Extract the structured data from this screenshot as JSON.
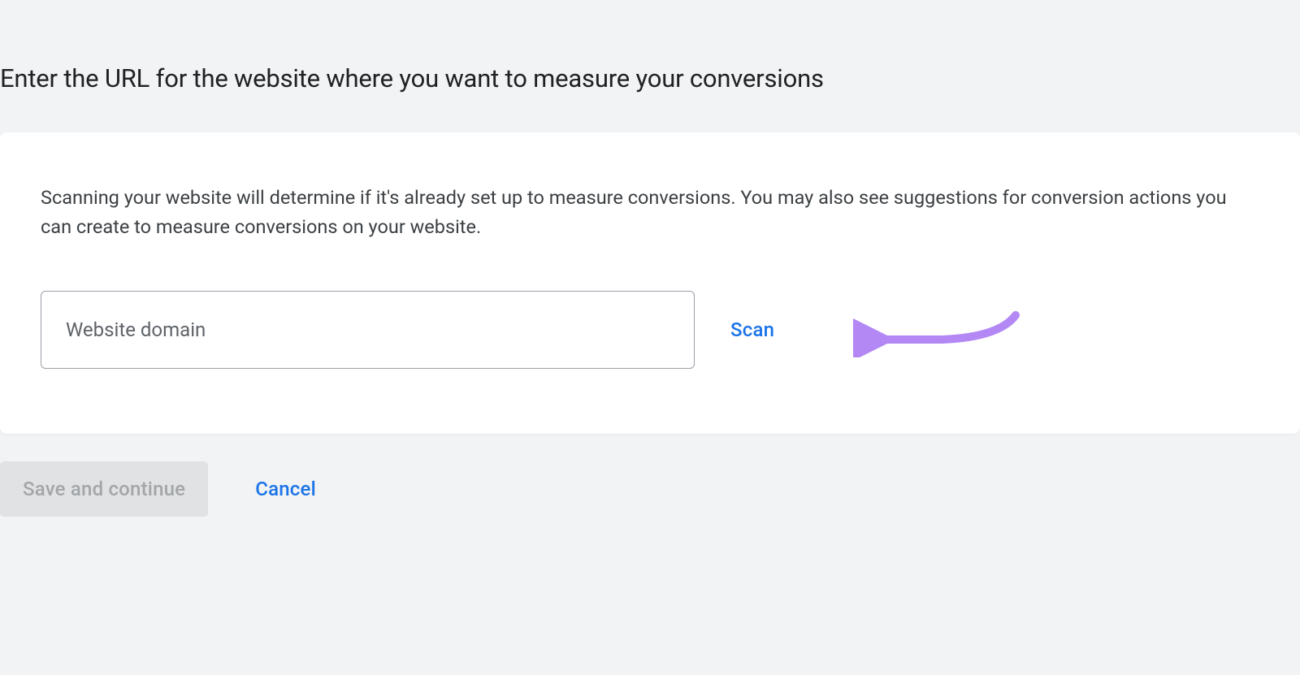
{
  "heading": "Enter the URL for the website where you want to measure your conversions",
  "card": {
    "description": "Scanning your website will determine if it's already set up to measure conversions. You may also see suggestions for conversion actions you can create to measure conversions on your website.",
    "domain_input": {
      "placeholder": "Website domain",
      "value": ""
    },
    "scan_label": "Scan"
  },
  "footer": {
    "save_label": "Save and continue",
    "cancel_label": "Cancel"
  },
  "colors": {
    "page_bg": "#f1f3f4",
    "card_bg": "#ffffff",
    "text_primary": "#202124",
    "text_secondary": "#3c4043",
    "link_blue": "#1a73e8",
    "disabled_bg": "#e0e2e3",
    "disabled_text": "#a3a6a8",
    "input_border": "#9aa0a6",
    "annotation_arrow": "#b388f5"
  }
}
